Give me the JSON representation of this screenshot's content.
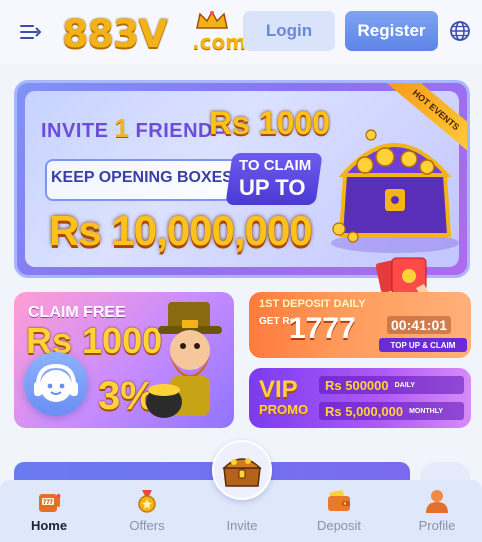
{
  "header": {
    "logo_main": "883V",
    "logo_sub": ".com",
    "login_label": "Login",
    "register_label": "Register"
  },
  "banner": {
    "invite_prefix": "INVITE",
    "invite_count": "1",
    "invite_suffix": "FRIEND=",
    "invite_amount": "Rs 1000",
    "keep_text": "KEEP OPENING BOXES",
    "claim_line1": "TO CLAIM",
    "claim_line2": "UP TO",
    "big_amount": "Rs 10,000,000",
    "ribbon": "HOT EVENTS"
  },
  "cards": {
    "free": {
      "title": "CLAIM FREE",
      "amount": "Rs 1000",
      "percent": "3%"
    },
    "deposit": {
      "title": "1ST DEPOSIT DAILY",
      "get": "GET Rs",
      "amount": "1777",
      "timer": "00:41:01",
      "cta": "TOP UP & CLAIM"
    },
    "vip": {
      "word": "VIP",
      "promo": "PROMO",
      "daily_amount": "Rs 500000",
      "daily_tag": "DAILY",
      "monthly_amount": "Rs 5,000,000",
      "monthly_tag": "MONTHLY"
    }
  },
  "nav": {
    "items": [
      {
        "label": "Home",
        "icon": "slot-machine-icon",
        "active": true
      },
      {
        "label": "Offers",
        "icon": "medal-icon",
        "active": false
      },
      {
        "label": "Invite",
        "icon": "treasure-chest-icon",
        "active": false
      },
      {
        "label": "Deposit",
        "icon": "wallet-icon",
        "active": false
      },
      {
        "label": "Profile",
        "icon": "user-icon",
        "active": false
      }
    ]
  },
  "colors": {
    "accent": "#6a8ef2",
    "gold": "#f3b317",
    "background": "#f2f4fb"
  }
}
